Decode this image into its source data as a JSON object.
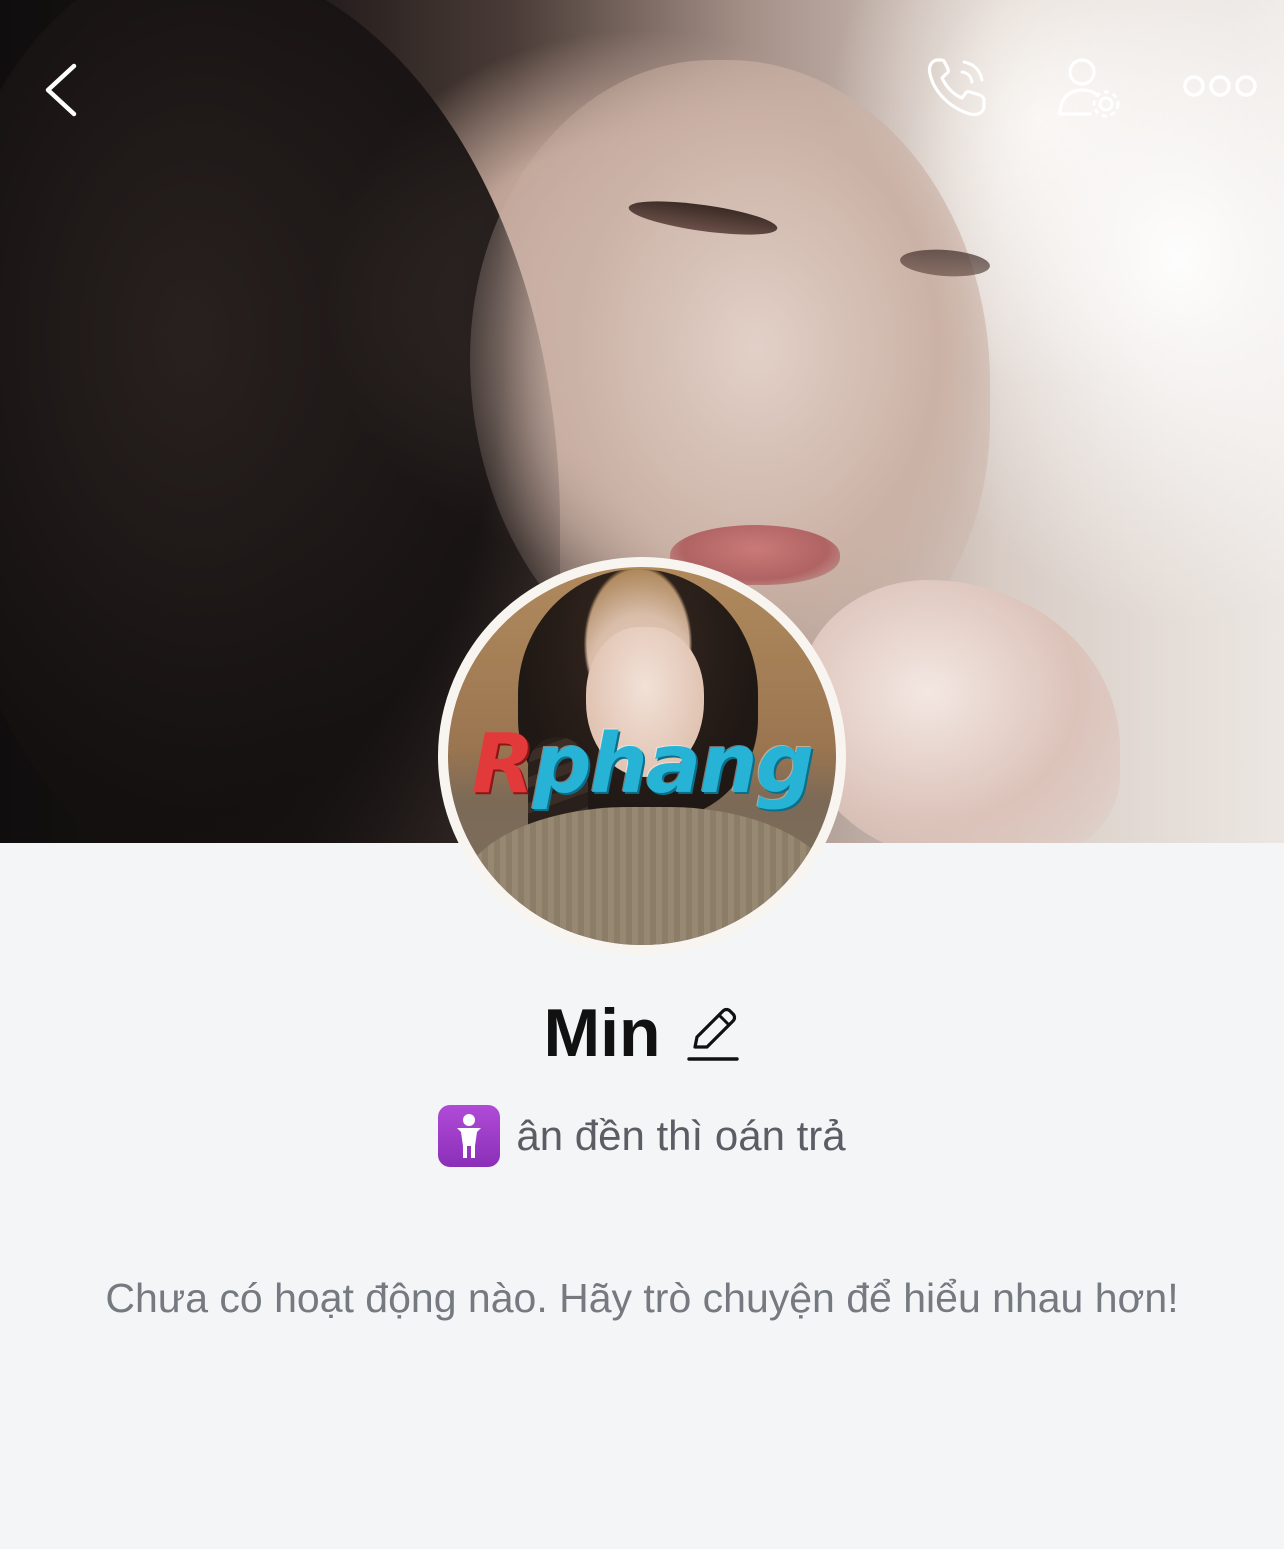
{
  "profile": {
    "name": "Min",
    "status_icon": "standing-woman-emoji",
    "status_text": "ân đền thì oán trả",
    "avatar_watermark_a": "R",
    "avatar_watermark_b": "phang"
  },
  "topbar": {
    "back_icon": "chevron-left-icon",
    "call_icon": "phone-icon",
    "settings_icon": "user-settings-icon",
    "more_icon": "more-dots-icon"
  },
  "feed": {
    "empty_message": "Chưa có hoạt động nào. Hãy trò chuyện để hiểu nhau hơn!"
  },
  "colors": {
    "background": "#f4f5f7",
    "name": "#111111",
    "status_text": "#5a5d63",
    "empty_message": "#757980",
    "status_emoji_bg": "#9b3cc8"
  }
}
